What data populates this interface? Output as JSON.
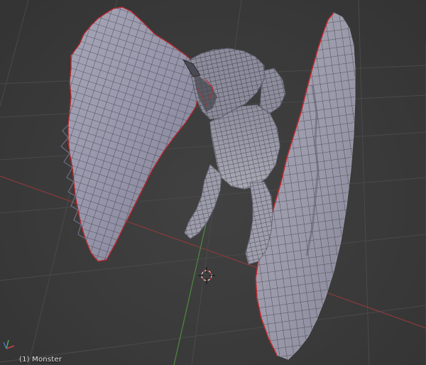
{
  "viewport": {
    "object_label": "(1) Monster",
    "colors": {
      "background": "#393939",
      "grid": "#4b4b4b",
      "x_axis": "#8a3a3a",
      "y_axis": "#4e8a3e",
      "mesh_fill": "#9a99ac",
      "mesh_wire": "#2a2a2e",
      "seam": "#c4262a"
    },
    "icons": [
      "3d-cursor-icon",
      "axis-gizmo-icon"
    ]
  }
}
